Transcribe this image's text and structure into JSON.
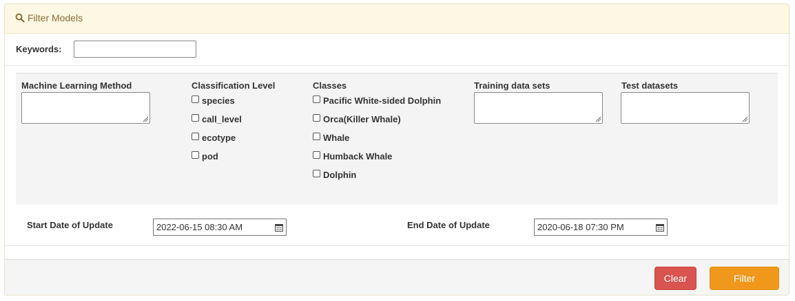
{
  "header": {
    "title": "Filter Models",
    "icon": "search-icon"
  },
  "keywords": {
    "label": "Keywords:",
    "value": ""
  },
  "columns": {
    "ml_method": {
      "label": "Machine Learning Method"
    },
    "classification_level": {
      "label": "Classification Level",
      "options": [
        "species",
        "call_level",
        "ecotype",
        "pod"
      ]
    },
    "classes": {
      "label": "Classes",
      "options": [
        "Pacific White-sided Dolphin",
        "Orca(Killer Whale)",
        "Whale",
        "Humback Whale",
        "Dolphin"
      ]
    },
    "training": {
      "label": "Training data sets"
    },
    "test": {
      "label": "Test datasets"
    }
  },
  "dates": {
    "start_label": "Start Date of Update",
    "start_value": "2022-06-15 08:30 AM",
    "end_label": "End Date of Update",
    "end_value": "2020-06-18 07:30 PM"
  },
  "buttons": {
    "clear": "Clear",
    "filter": "Filter"
  },
  "colors": {
    "clear": "#d9534f",
    "filter": "#f0981c",
    "header_bg": "#fcf8e3",
    "header_text": "#8a6d3b"
  }
}
